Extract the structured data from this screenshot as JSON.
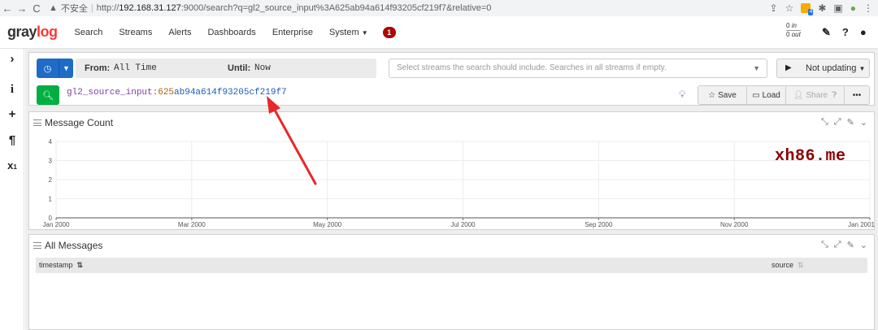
{
  "browser": {
    "warning": "不安全",
    "url_host": "192.168.31.127",
    "url_rest": ":9000/search?q=gl2_source_input%3A625ab94a614f93205cf219f7&relative=0",
    "url_prefix": "http://",
    "ext_badge": "4"
  },
  "nav": {
    "logo_a": "gray",
    "logo_b": "log",
    "items": [
      "Search",
      "Streams",
      "Alerts",
      "Dashboards",
      "Enterprise",
      "System"
    ],
    "notification_count": "1",
    "throughput_in": "0",
    "throughput_in_label": "in",
    "throughput_out": "0",
    "throughput_out_label": "out"
  },
  "sidebar": {
    "icons": [
      "chevron-right-icon",
      "info-icon",
      "plus-icon",
      "paragraph-icon",
      "subscript-icon"
    ]
  },
  "search": {
    "from_label": "From:",
    "from_value": "All Time",
    "until_label": "Until:",
    "until_value": "Now",
    "streams_placeholder": "Select streams the search should include. Searches in all streams if empty.",
    "refresh_label": "Not updating",
    "query_field": "gl2_source_input:",
    "query_num": "625",
    "query_hash": "ab94a614f93205cf219f7",
    "save_label": "Save",
    "load_label": "Load",
    "share_label": "Share"
  },
  "message_count": {
    "title": "Message Count"
  },
  "all_messages": {
    "title": "All Messages",
    "columns": [
      "timestamp",
      "source"
    ]
  },
  "watermark": "xh86.me",
  "colors": {
    "graylog_red": "#ff3633",
    "primary_blue": "#1f6bc8",
    "success_green": "#00ae42",
    "badge_red": "#ad0707",
    "arrow_red": "#e8282b"
  },
  "chart_data": {
    "type": "line",
    "title": "Message Count",
    "x_ticks": [
      "Jan 2000",
      "Mar 2000",
      "May 2000",
      "Jul 2000",
      "Sep 2000",
      "Nov 2000",
      "Jan 2001"
    ],
    "y_ticks": [
      0,
      1,
      2,
      3,
      4
    ],
    "ylim": [
      0,
      4
    ],
    "grid": true,
    "series": []
  }
}
